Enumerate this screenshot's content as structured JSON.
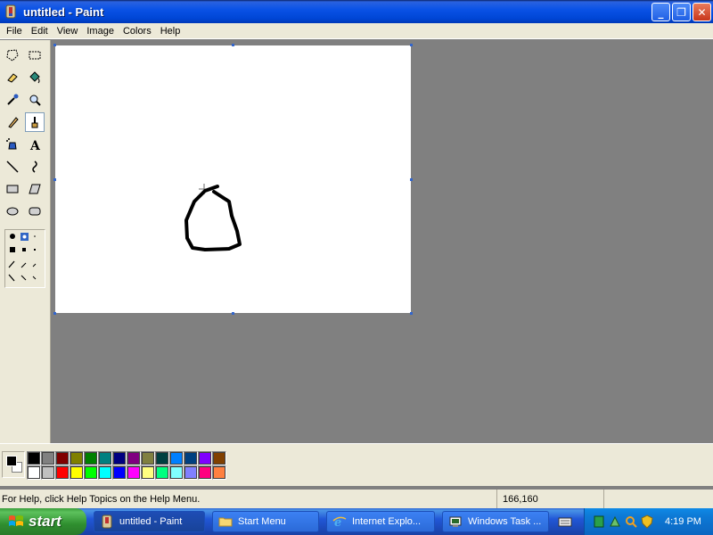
{
  "window": {
    "title": "untitled - Paint",
    "buttons": {
      "minimize": "_",
      "maximize": "❐",
      "close": "✕"
    }
  },
  "menu": [
    "File",
    "Edit",
    "View",
    "Image",
    "Colors",
    "Help"
  ],
  "tools": [
    "free-form-select-icon",
    "select-icon",
    "eraser-icon",
    "fill-bucket-icon",
    "pick-color-icon",
    "magnifier-icon",
    "pencil-icon",
    "brush-icon",
    "airbrush-icon",
    "text-icon",
    "line-icon",
    "curve-icon",
    "rectangle-icon",
    "polygon-icon",
    "ellipse-icon",
    "rounded-rectangle-icon"
  ],
  "active_tool": "brush-icon",
  "palette": {
    "foreground": "#000000",
    "background": "#ffffff",
    "row1": [
      "#000000",
      "#808080",
      "#800000",
      "#808000",
      "#008000",
      "#008080",
      "#000080",
      "#800080",
      "#808040",
      "#004040",
      "#0080ff",
      "#004080",
      "#8000ff",
      "#804000"
    ],
    "row2": [
      "#ffffff",
      "#c0c0c0",
      "#ff0000",
      "#ffff00",
      "#00ff00",
      "#00ffff",
      "#0000ff",
      "#ff00ff",
      "#ffff80",
      "#00ff80",
      "#80ffff",
      "#8080ff",
      "#ff0080",
      "#ff8040"
    ]
  },
  "status": {
    "help": "For Help, click Help Topics on the Help Menu.",
    "coords": "166,160"
  },
  "taskbar": {
    "start": "start",
    "tasks": [
      {
        "label": "untitled - Paint",
        "active": true
      },
      {
        "label": "Start Menu",
        "active": false
      },
      {
        "label": "Internet Explo...",
        "active": false
      },
      {
        "label": "Windows Task ...",
        "active": false
      }
    ],
    "clock": "4:19 PM"
  }
}
